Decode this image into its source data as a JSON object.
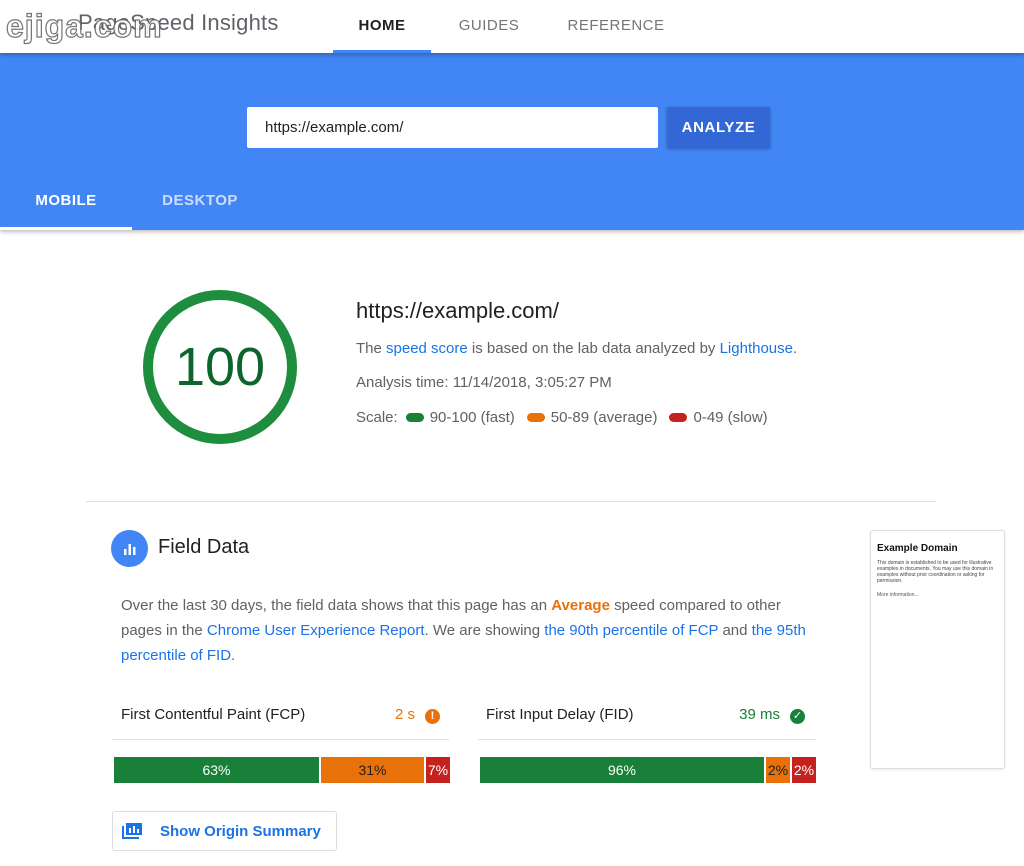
{
  "watermark": "ejiga.com",
  "header": {
    "brand": "PageSpeed Insights",
    "tabs": [
      {
        "label": "HOME",
        "active": true
      },
      {
        "label": "GUIDES",
        "active": false
      },
      {
        "label": "REFERENCE",
        "active": false
      }
    ]
  },
  "search": {
    "value": "https://example.com/",
    "button_label": "ANALYZE"
  },
  "device_tabs": [
    {
      "label": "MOBILE",
      "active": true
    },
    {
      "label": "DESKTOP",
      "active": false
    }
  ],
  "score": {
    "value": "100",
    "ring_color": "#1e8e3e",
    "ring_fraction": 1.0
  },
  "summary": {
    "url": "https://example.com/",
    "line1_pre": "The ",
    "line1_link1": "speed score",
    "line1_mid": " is based on the lab data analyzed by ",
    "line1_link2": "Lighthouse",
    "line1_post": ".",
    "analysis_time": "Analysis time: 11/14/2018, 3:05:27 PM",
    "scale_label": "Scale:",
    "scale": [
      {
        "label": "90-100 (fast)",
        "color": "#188038"
      },
      {
        "label": "50-89 (average)",
        "color": "#e8710a"
      },
      {
        "label": "0-49 (slow)",
        "color": "#c5221f"
      }
    ]
  },
  "field_data": {
    "title": "Field Data",
    "desc_1": "Over the last 30 days, the field data shows that this page has an ",
    "desc_avg": "Average",
    "desc_2": " speed compared to other pages in the ",
    "desc_link1": "Chrome User Experience Report",
    "desc_3": ". We are showing ",
    "desc_link2": "the 90th percentile of FCP",
    "desc_4": " and ",
    "desc_link3": "the 95th percentile of FID",
    "desc_5": ".",
    "metrics": [
      {
        "label": "First Contentful Paint (FCP)",
        "value": "2 s",
        "value_color": "#e8710a",
        "status_icon": "info-icon",
        "status_glyph": "!",
        "distribution": [
          {
            "label": "63%",
            "pct": 63,
            "kind": "fast"
          },
          {
            "label": "31%",
            "pct": 31,
            "kind": "avg"
          },
          {
            "label": "7%",
            "pct": 7,
            "kind": "slow"
          }
        ]
      },
      {
        "label": "First Input Delay (FID)",
        "value": "39 ms",
        "value_color": "#188038",
        "status_icon": "check-icon",
        "status_glyph": "✓",
        "distribution": [
          {
            "label": "96%",
            "pct": 96,
            "kind": "fast"
          },
          {
            "label": "2%",
            "pct": 2,
            "kind": "avg"
          },
          {
            "label": "2%",
            "pct": 2,
            "kind": "slow"
          }
        ]
      }
    ],
    "origin_button": "Show Origin Summary"
  },
  "thumbnail": {
    "title": "Example Domain",
    "body": "This domain is established to be used for illustrative examples in documents. You may use this domain in examples without prior coordination or asking for permission.",
    "link": "More information..."
  }
}
